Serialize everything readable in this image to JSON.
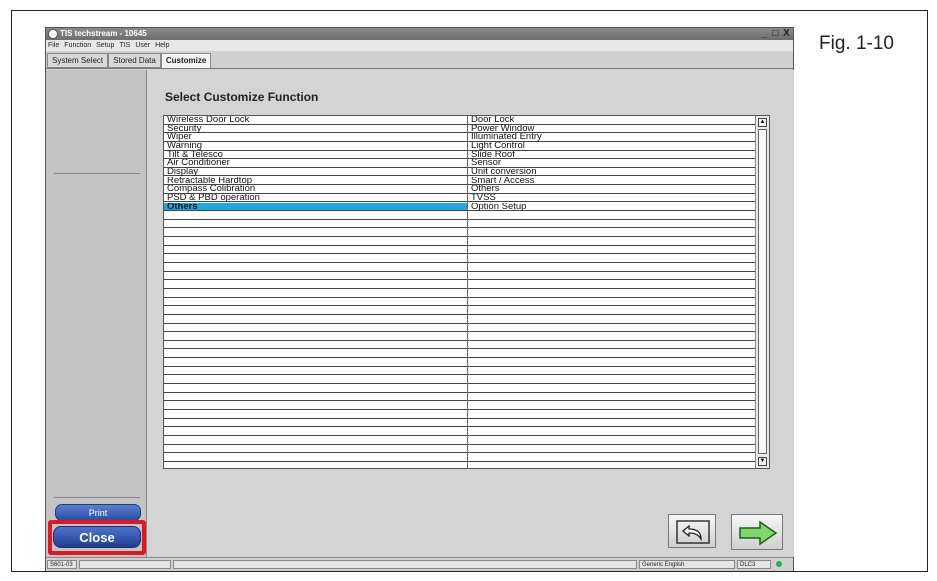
{
  "figure_label": "Fig. 1-10",
  "window": {
    "title": "TIS techstream - 10645",
    "controls": {
      "minimize": "_",
      "maximize": "□",
      "close": "X"
    }
  },
  "menu": [
    "File",
    "Function",
    "Setup",
    "TIS",
    "User",
    "Help"
  ],
  "tabs": [
    {
      "label": "System Select"
    },
    {
      "label": "Stored Data"
    },
    {
      "label": "Customize",
      "active": true
    }
  ],
  "left_panel": {
    "print_label": "Print",
    "close_label": "Close"
  },
  "main": {
    "heading": "Select Customize Function",
    "rows": [
      {
        "col1": "Wireless Door Lock",
        "col2": "Door Lock"
      },
      {
        "col1": "Security",
        "col2": "Power Window"
      },
      {
        "col1": "Wiper",
        "col2": "Illuminated Entry"
      },
      {
        "col1": "Warning",
        "col2": "Light Control"
      },
      {
        "col1": "Tilt & Telesco",
        "col2": "Slide Roof"
      },
      {
        "col1": "Air Conditioner",
        "col2": "Sensor"
      },
      {
        "col1": "Display",
        "col2": "Unit conversion"
      },
      {
        "col1": "Retractable Hardtop",
        "col2": "Smart / Access"
      },
      {
        "col1": "Compass Colibration",
        "col2": "Others"
      },
      {
        "col1": "PSD & PBD operation",
        "col2": "TVSS"
      },
      {
        "col1": "Others",
        "col2": "Option Setup",
        "selected": true
      },
      {
        "col1": "",
        "col2": ""
      },
      {
        "col1": "",
        "col2": ""
      },
      {
        "col1": "",
        "col2": ""
      },
      {
        "col1": "",
        "col2": ""
      },
      {
        "col1": "",
        "col2": ""
      },
      {
        "col1": "",
        "col2": ""
      },
      {
        "col1": "",
        "col2": ""
      },
      {
        "col1": "",
        "col2": ""
      },
      {
        "col1": "",
        "col2": ""
      },
      {
        "col1": "",
        "col2": ""
      },
      {
        "col1": "",
        "col2": ""
      },
      {
        "col1": "",
        "col2": ""
      },
      {
        "col1": "",
        "col2": ""
      },
      {
        "col1": "",
        "col2": ""
      },
      {
        "col1": "",
        "col2": ""
      },
      {
        "col1": "",
        "col2": ""
      },
      {
        "col1": "",
        "col2": ""
      },
      {
        "col1": "",
        "col2": ""
      },
      {
        "col1": "",
        "col2": ""
      },
      {
        "col1": "",
        "col2": ""
      },
      {
        "col1": "",
        "col2": ""
      },
      {
        "col1": "",
        "col2": ""
      },
      {
        "col1": "",
        "col2": ""
      },
      {
        "col1": "",
        "col2": ""
      },
      {
        "col1": "",
        "col2": ""
      },
      {
        "col1": "",
        "col2": ""
      },
      {
        "col1": "",
        "col2": ""
      },
      {
        "col1": "",
        "col2": ""
      },
      {
        "col1": "",
        "col2": ""
      }
    ],
    "back_icon": "undo-arrow-icon",
    "next_icon": "right-arrow-icon"
  },
  "statusbar": {
    "code": "S601-03",
    "language": "Generic English",
    "connection": "DLC3",
    "connection_color": "#22b14c"
  },
  "colors": {
    "selected_row": "#1ea7e6",
    "close_highlight": "#e3171f",
    "button_blue": "#2c4fa3"
  }
}
